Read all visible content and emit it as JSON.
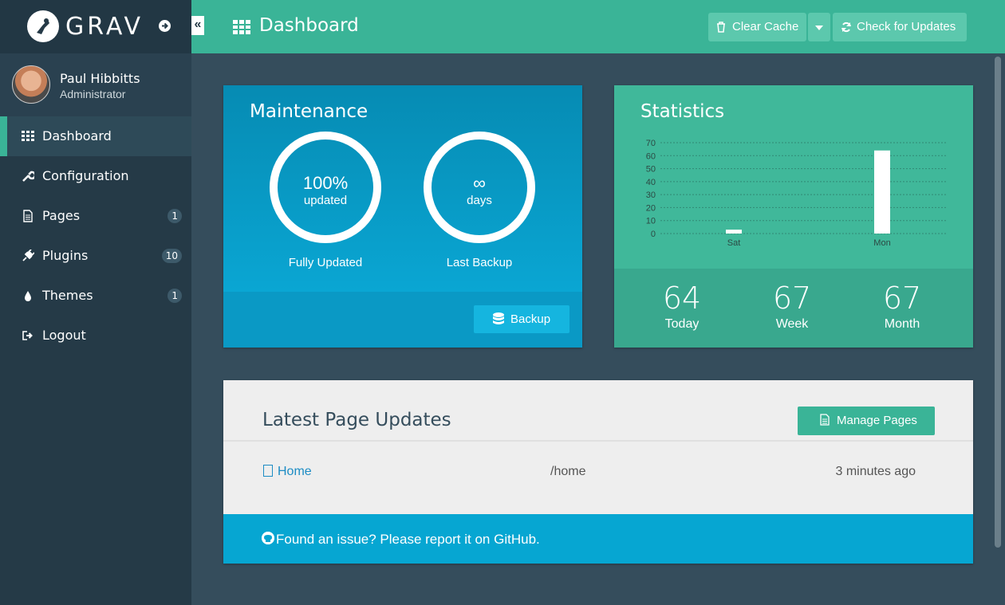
{
  "brand": {
    "name": "GRAV"
  },
  "user": {
    "name": "Paul Hibbitts",
    "role": "Administrator"
  },
  "sidebar": {
    "items": [
      {
        "label": "Dashboard",
        "icon": "grid-icon",
        "active": true
      },
      {
        "label": "Configuration",
        "icon": "wrench-icon"
      },
      {
        "label": "Pages",
        "icon": "file-icon",
        "badge": "1"
      },
      {
        "label": "Plugins",
        "icon": "plug-icon",
        "badge": "10"
      },
      {
        "label": "Themes",
        "icon": "drop-icon",
        "badge": "1"
      },
      {
        "label": "Logout",
        "icon": "signout-icon"
      }
    ]
  },
  "header": {
    "title": "Dashboard",
    "clear_cache": "Clear Cache",
    "check_updates": "Check for Updates"
  },
  "maintenance": {
    "title": "Maintenance",
    "updated_value": "100%",
    "updated_unit": "updated",
    "updated_caption": "Fully Updated",
    "backup_value": "∞",
    "backup_unit": "days",
    "backup_caption": "Last Backup",
    "backup_button": "Backup"
  },
  "statistics": {
    "title": "Statistics",
    "today_value": "64",
    "today_label": "Today",
    "week_value": "67",
    "week_label": "Week",
    "month_value": "67",
    "month_label": "Month"
  },
  "chart_data": {
    "type": "bar",
    "categories": [
      "Sat",
      "Mon"
    ],
    "values": [
      3,
      64
    ],
    "ylim": [
      0,
      70
    ],
    "yticks": [
      0,
      10,
      20,
      30,
      40,
      50,
      60,
      70
    ]
  },
  "latest": {
    "title": "Latest Page Updates",
    "manage_button": "Manage Pages",
    "rows": [
      {
        "title": "Home",
        "route": "/home",
        "time": "3 minutes ago"
      }
    ],
    "footer": "Found an issue? Please report it on GitHub."
  },
  "colors": {
    "accent": "#3ab497",
    "maintenance": "#0a99c5",
    "sidebar": "#253a47"
  }
}
